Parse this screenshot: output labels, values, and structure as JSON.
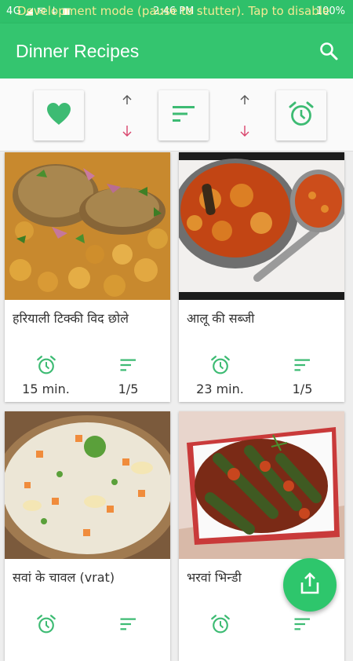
{
  "status_bar": {
    "left_icons": "4G ◢ ✉ ↓ ◼",
    "overlay_text": "Development mode (pause to stutter). Tap to disable",
    "time": "2:46 PM",
    "battery": "100%"
  },
  "app_bar": {
    "title": "Dinner Recipes",
    "search_icon": "search-icon"
  },
  "toolbar": {
    "favorite_icon": "heart-icon",
    "sort_icon": "sort-icon",
    "timer_icon": "alarm-icon",
    "colors": {
      "accent": "#3dbb73",
      "up_arrow": "#555555",
      "down_arrow": "#d9436b"
    }
  },
  "recipes": [
    {
      "name": "हरियाली टिक्की विद छोले",
      "time": "15 min.",
      "difficulty": "1/5"
    },
    {
      "name": "आलू की सब्जी",
      "time": "23 min.",
      "difficulty": "1/5"
    },
    {
      "name": "सवां के चावल (vrat)",
      "time": "",
      "difficulty": ""
    },
    {
      "name": "भरवां भिन्डी",
      "time": "",
      "difficulty": ""
    }
  ],
  "fab": {
    "icon": "share-icon"
  }
}
